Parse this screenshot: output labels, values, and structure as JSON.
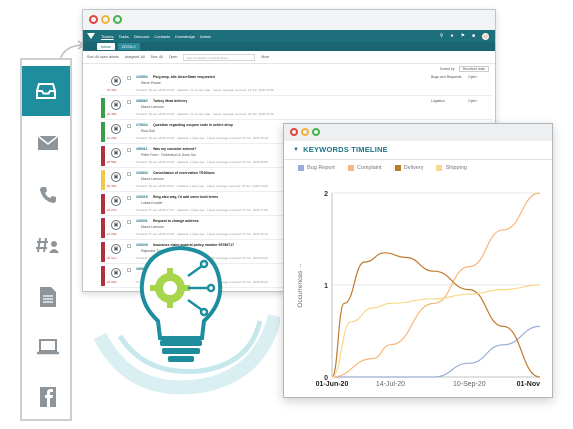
{
  "app": {
    "window_controls": [
      "close",
      "minimize",
      "maximize"
    ],
    "nav": [
      "Tickets",
      "Tasks",
      "Discount",
      "Contacts",
      "Knowledge",
      "Admin"
    ],
    "active_nav": "Tickets",
    "tabs": [
      "Inbox",
      "ZDS9-0"
    ],
    "filters": [
      "Sort: All open tickets",
      "Assigned: All",
      "Due: All",
      "Open"
    ],
    "search_placeholder": "Type to search or refresh items",
    "more": "More",
    "sorted_by_label": "Sorted by",
    "sorted_by_value": "Received date",
    "tickets": [
      {
        "id": "#29554",
        "subject": "Plug amp, idle AirserState enquested",
        "who": "Steve Pease",
        "time": "2h 32m",
        "category": "Bugs and Requests",
        "status": "Open",
        "bar": "#ffffff",
        "meta": "Created: 18 Jun, 2020 10:04 · Updated: 13 minutes ago · Latest message received: 13 Jun, 2020 10:08"
      },
      {
        "id": "#68062",
        "subject": "Turkey Meat delivery",
        "who": "Diana Larsons",
        "time": "3h 48m",
        "category": "Logistics",
        "status": "Open",
        "bar": "#3a9b4c",
        "meta": "Created: 18 Jun, 2020 15:04 · Updated: 13 minutes ago · Latest message received: 18 Jun, 2020 10:29"
      },
      {
        "id": "#79024",
        "subject": "Question regarding coupon code in online shop",
        "who": "Elsa Doll",
        "time": "1h 20m",
        "category": "Marketing",
        "status": "Open",
        "bar": "#3a9b4c",
        "meta": "Created: 18 Jun, 2020 15:04 · Updated: 1 days ago · Latest message received: 16 Jun, 2020 10:18"
      },
      {
        "id": "#89011",
        "subject": "Was my consider arrived?",
        "who": "Peter Fenn · Robertson & Sons Inc.",
        "time": "0h 58m",
        "category": "",
        "status": "",
        "bar": "#b03040",
        "meta": "Created: 18 Jun, 2020 15:04 · Updated: 2 days ago · Latest message received: 15 Jun, 2020 08:50"
      },
      {
        "id": "#33843",
        "subject": "Cancellation of reservation TR20bcm",
        "who": "Diana Larsons",
        "time": "5h 39m",
        "category": "",
        "status": "",
        "bar": "#f0c94a",
        "meta": "Created: 18 Jun, 2020 16:11 · Updated: 2 days ago · Latest message received: 18 Jun, 2020 10:28"
      },
      {
        "id": "#33019",
        "subject": "Ring also way, I'd add some bold terms",
        "who": "Lukas Kunder",
        "time": "2h 27m",
        "category": "",
        "status": "",
        "bar": "#b03040",
        "meta": "Created: 17 Jun, 2020 17:07 · Updated: 3 days ago · Latest message received: 17 Jun, 2020 17:09"
      },
      {
        "id": "#30001",
        "subject": "Request to change address",
        "who": "Diana Larsons",
        "time": "1h 09m",
        "category": "",
        "status": "",
        "bar": "#b03040",
        "meta": "Created: 17 Jun, 2020 12:10 · Updated: 4 days ago · Latest message received: 17 Jun, 2020 12:10"
      },
      {
        "id": "#30049",
        "subject": "Insurance claim against policy number 99786717",
        "who": "Rajendra Turkey",
        "time": "4h 11m",
        "category": "",
        "status": "",
        "bar": "#b03040",
        "meta": "Created: 16 Jun, 2020 09:43 · Updated: 4 days ago · Latest message received: 16 Jun, 2020 09:43"
      },
      {
        "id": "#69009",
        "subject": "Refund request",
        "who": "Thomas Lowell",
        "time": "2h 02m",
        "category": "",
        "status": "",
        "bar": "#b03040",
        "meta": "Created: 16 Jun, 2020 08:20 · Updated: 5 days ago · Latest message received: 16 Jun, 2020 08:20"
      }
    ]
  },
  "sidebar": {
    "items": [
      {
        "icon": "inbox-icon",
        "active": true
      },
      {
        "icon": "envelope-icon",
        "active": false
      },
      {
        "icon": "phone-icon",
        "active": false
      },
      {
        "icon": "hashtag-user-icon",
        "active": false
      },
      {
        "icon": "document-icon",
        "active": false
      },
      {
        "icon": "laptop-icon",
        "active": false
      },
      {
        "icon": "facebook-icon",
        "active": false
      }
    ]
  },
  "timeline": {
    "title": "KEYWORDS TIMELINE",
    "colors": {
      "accent": "#1e7585"
    }
  },
  "chart_data": {
    "type": "line",
    "title": "KEYWORDS TIMELINE",
    "xlabel": "",
    "ylabel": "Occurrences →",
    "x_ticks": [
      "01-Jun-20",
      "14-Jul-20",
      "10-Sep-20",
      "01-Nov"
    ],
    "y_ticks": [
      "0",
      "1",
      "2"
    ],
    "ylim": [
      0,
      2
    ],
    "xlim": [
      "2020-06-01",
      "2020-11-01"
    ],
    "grid": true,
    "legend": "top-left",
    "series": [
      {
        "name": "Bug Report",
        "color": "#9aaed4",
        "x": [
          "2020-06-01",
          "2020-07-14",
          "2020-08-15",
          "2020-09-10",
          "2020-10-05",
          "2020-11-01"
        ],
        "values": [
          0,
          0,
          0,
          0.15,
          0.35,
          0.55
        ]
      },
      {
        "name": "Complaint",
        "color": "#f5b77a",
        "x": [
          "2020-06-01",
          "2020-07-01",
          "2020-07-14",
          "2020-08-15",
          "2020-09-10",
          "2020-10-05",
          "2020-11-01"
        ],
        "values": [
          0,
          0.2,
          0.35,
          0.8,
          1.2,
          1.6,
          2.0
        ]
      },
      {
        "name": "Delivery",
        "color": "#c07a30",
        "x": [
          "2020-06-01",
          "2020-06-10",
          "2020-06-25",
          "2020-07-10",
          "2020-07-25",
          "2020-08-15",
          "2020-09-10",
          "2020-10-05",
          "2020-11-01"
        ],
        "values": [
          0,
          0.8,
          1.25,
          1.35,
          1.3,
          1.15,
          0.95,
          0.55,
          0
        ]
      },
      {
        "name": "Shipping",
        "color": "#f6d98a",
        "x": [
          "2020-06-01",
          "2020-06-15",
          "2020-07-01",
          "2020-07-14",
          "2020-08-15",
          "2020-09-10",
          "2020-10-05",
          "2020-11-01"
        ],
        "values": [
          0,
          0.6,
          0.75,
          0.8,
          0.85,
          0.9,
          0.95,
          1.0
        ]
      }
    ]
  }
}
